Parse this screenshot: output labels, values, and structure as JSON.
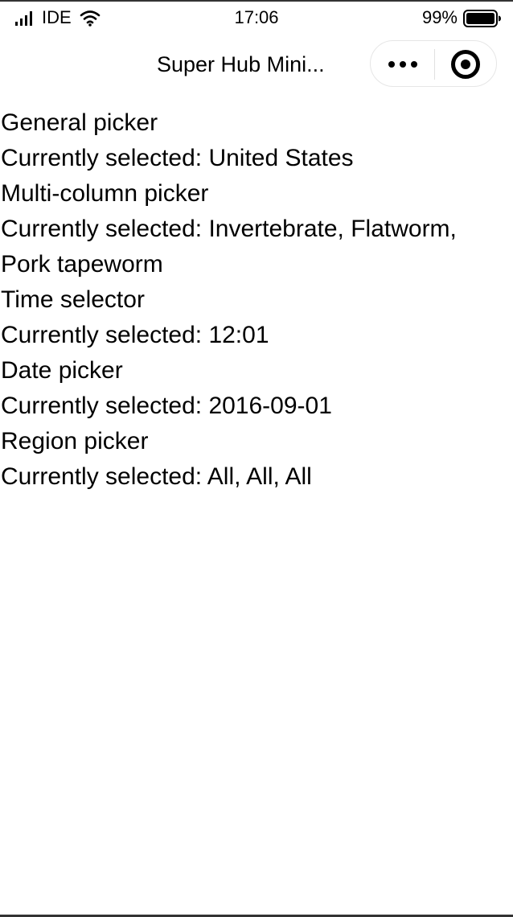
{
  "status_bar": {
    "carrier": "IDE",
    "time": "17:06",
    "battery": "99%",
    "icons": [
      "signal-icon",
      "wifi-icon",
      "battery-icon"
    ]
  },
  "nav": {
    "title": "Super Hub Mini...",
    "icons": [
      "more-icon",
      "close-icon"
    ]
  },
  "pickers": [
    {
      "label": "General picker",
      "selected_line": "Currently selected: United States"
    },
    {
      "label": "Multi-column picker",
      "selected_line": "Currently selected: Invertebrate, Flatworm,",
      "selected_line_cont": "Pork tapeworm"
    },
    {
      "label": "Time selector",
      "selected_line": "Currently selected: 12:01"
    },
    {
      "label": "Date picker",
      "selected_line": "Currently selected: 2016-09-01"
    },
    {
      "label": "Region picker",
      "selected_line": "Currently selected: All, All, All"
    }
  ]
}
